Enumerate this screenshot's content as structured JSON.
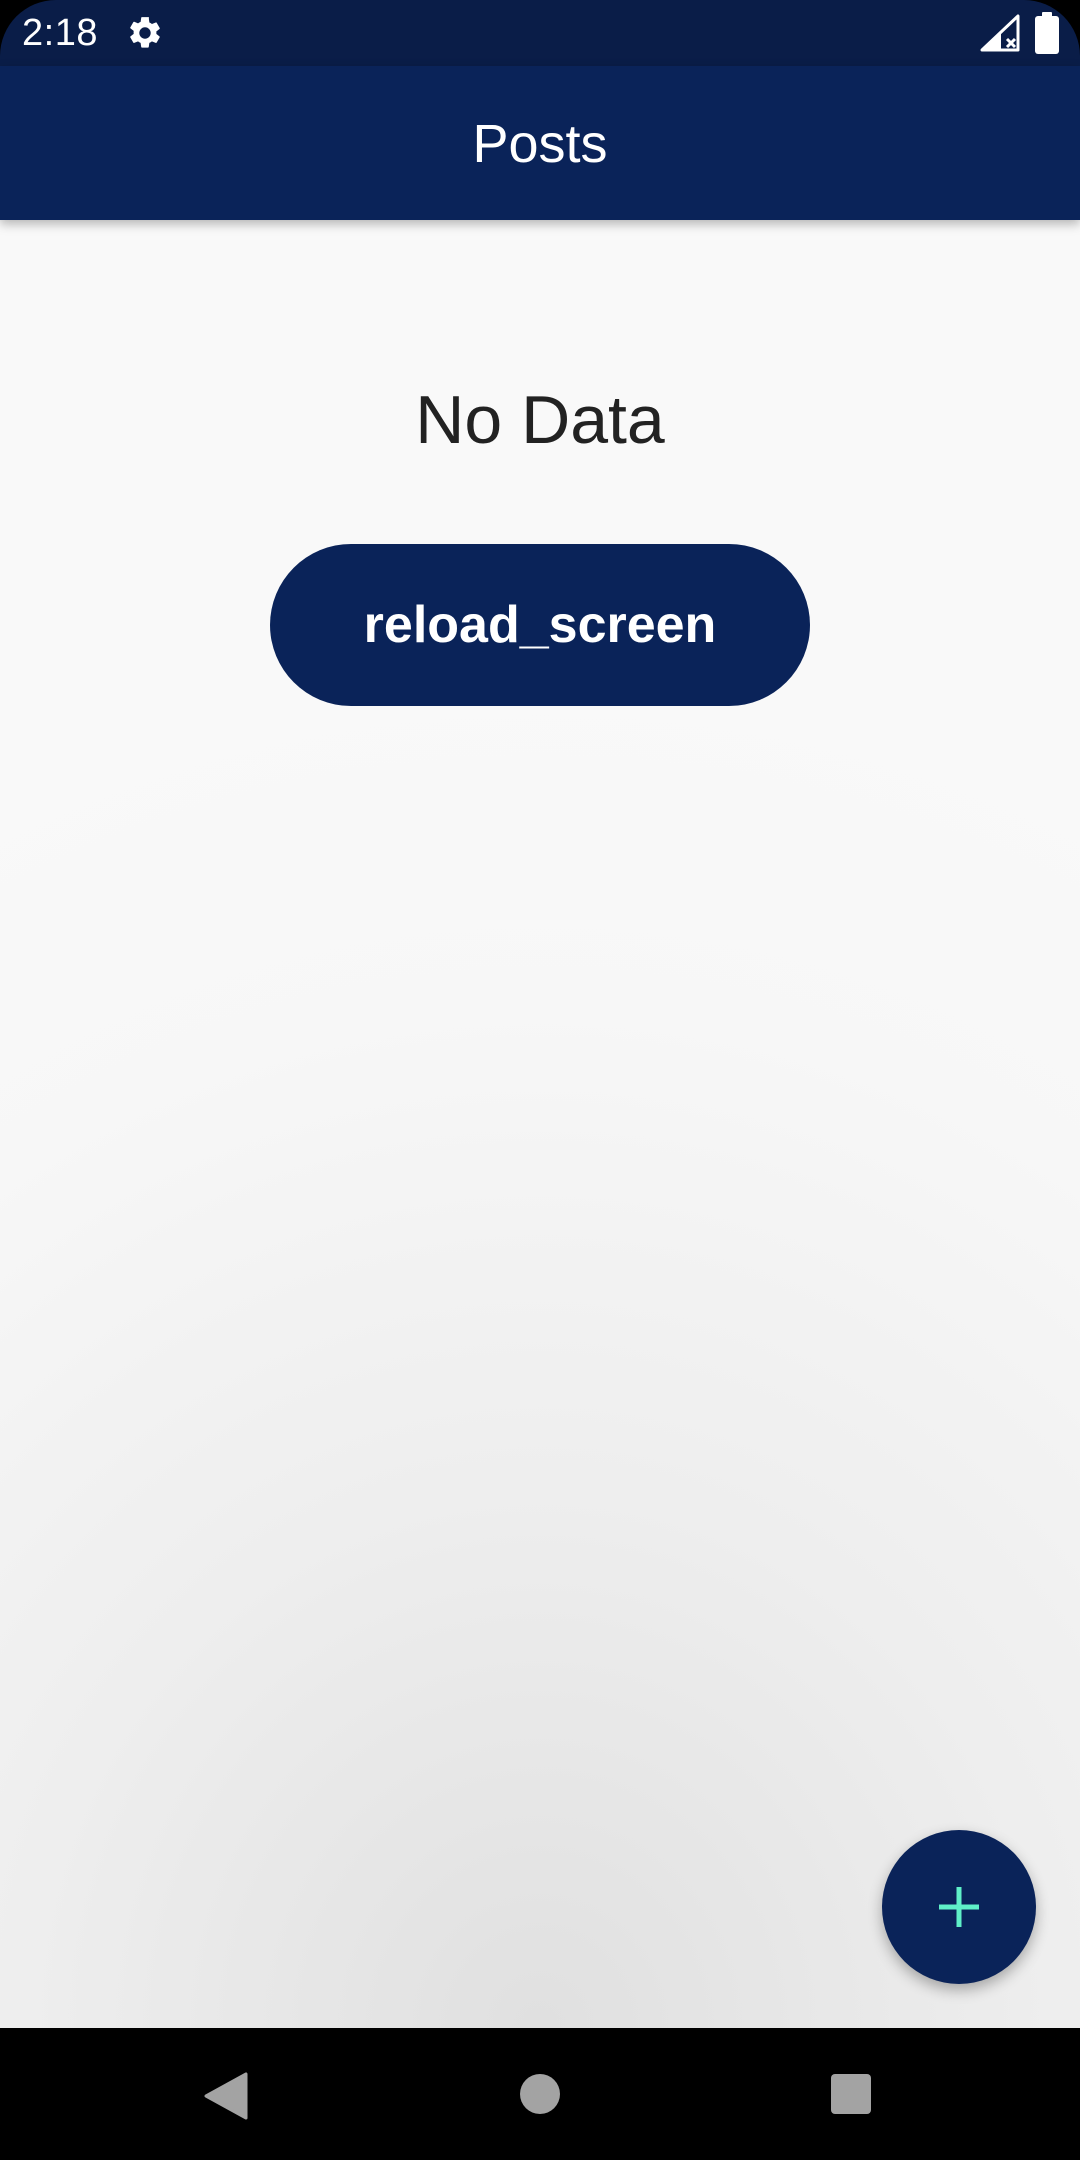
{
  "status_bar": {
    "time": "2:18",
    "icons": [
      "settings-icon",
      "signal-no-service-icon",
      "battery-icon"
    ]
  },
  "app_bar": {
    "title": "Posts",
    "color": "#0a2359"
  },
  "content": {
    "empty_message": "No Data",
    "reload_label": "reload_screen"
  },
  "fab": {
    "icon": "plus-icon",
    "icon_color": "#5ff0c8"
  },
  "nav_bar": {
    "buttons": [
      "back-icon",
      "home-icon",
      "recents-icon"
    ]
  }
}
